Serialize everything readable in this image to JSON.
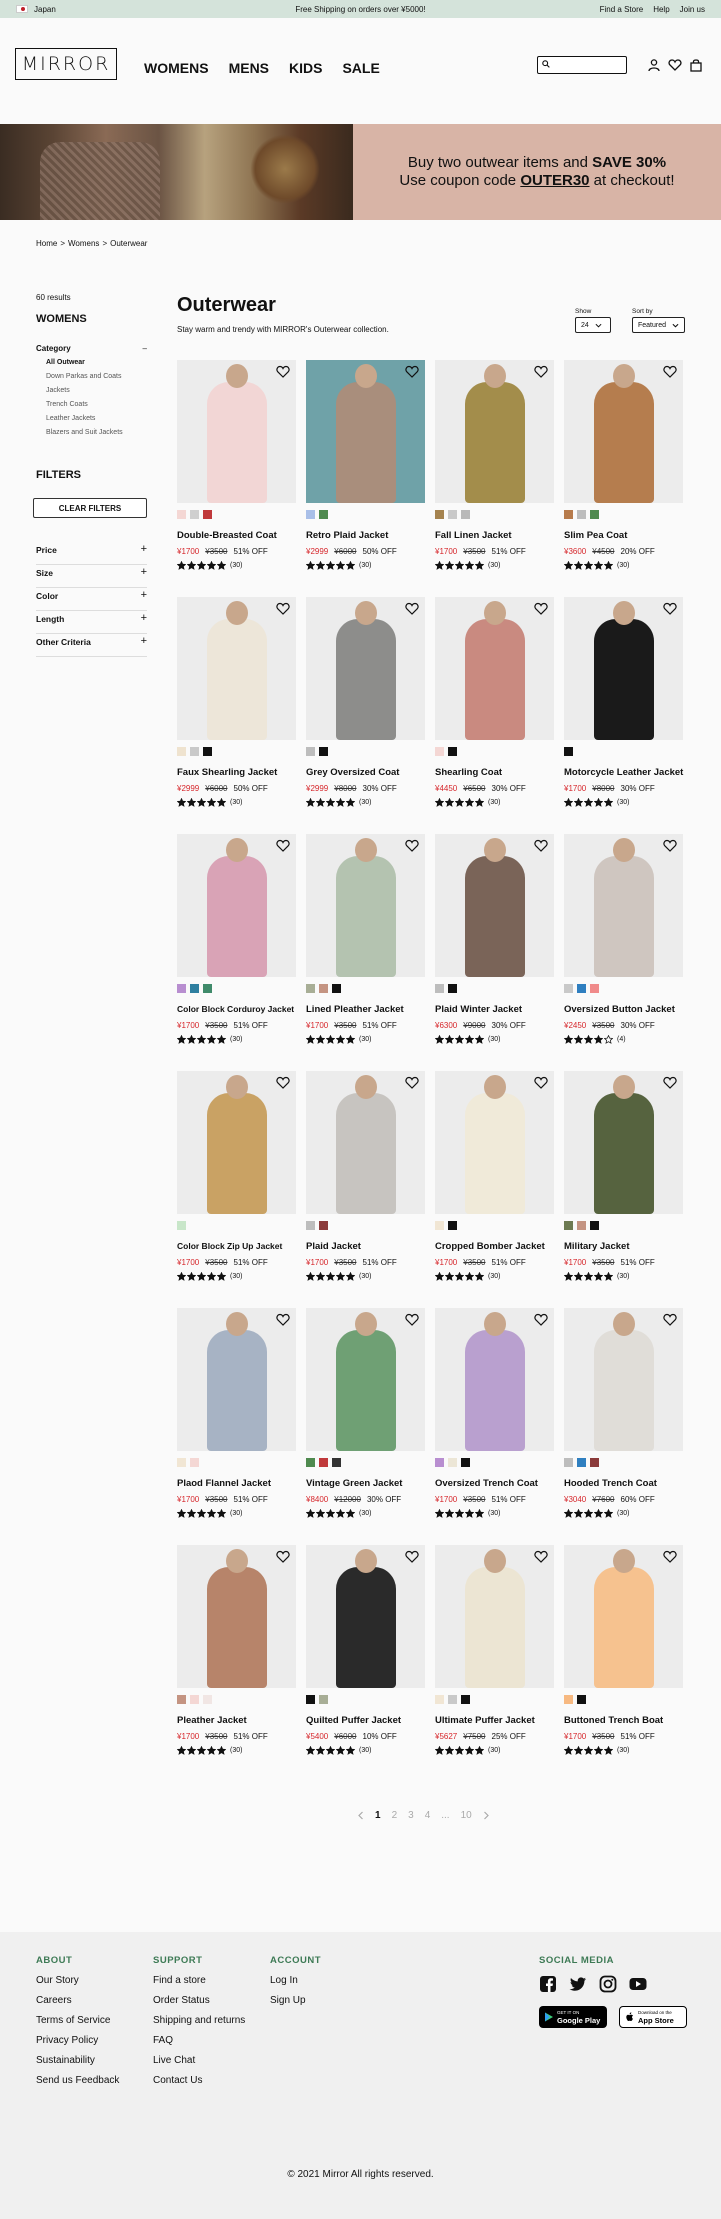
{
  "topbar": {
    "country": "Japan",
    "promo": "Free Shipping on orders over ¥5000!",
    "links": [
      "Find a Store",
      "Help",
      "Join us"
    ]
  },
  "header": {
    "logo": "MIRROR",
    "nav": [
      "WOMENS",
      "MENS",
      "KIDS",
      "SALE"
    ],
    "search_placeholder": "",
    "icons": [
      "user-icon",
      "heart-icon",
      "bag-icon"
    ]
  },
  "hero": {
    "line1_pre": "Buy two outwear items and ",
    "line1_bold": "SAVE 30%",
    "line2_pre": "Use coupon code ",
    "line2_code": "OUTER30",
    "line2_post": " at checkout!"
  },
  "breadcrumb": [
    "Home",
    ">",
    "Womens",
    ">",
    "Outerwear"
  ],
  "sidebar": {
    "results": "60 results",
    "section": "WOMENS",
    "category_label": "Category",
    "category_toggle": "–",
    "categories": [
      "All Outwear",
      "Down Parkas and Coats",
      "Jackets",
      "Trench Coats",
      "Leather Jackets",
      "Blazers and Suit Jackets"
    ],
    "active_category": "All Outwear",
    "filters_title": "FILTERS",
    "clear_filters": "CLEAR FILTERS",
    "facets": [
      "Price",
      "Size",
      "Color",
      "Length",
      "Other Criteria"
    ]
  },
  "content": {
    "title": "Outerwear",
    "subtitle": "Stay warm and trendy with MIRROR's Outerwear collection.",
    "show_label": "Show",
    "show_value": "24",
    "sort_label": "Sort by",
    "sort_value": "Featured"
  },
  "products": [
    {
      "name": "Double-Breasted Coat",
      "sale": "¥1700",
      "orig": "¥3500",
      "off": "51% OFF",
      "stars": 5,
      "reviews": "(30)",
      "swatches": [
        "#f4d7d4",
        "#cfcfcf",
        "#c0393b"
      ],
      "coat": "#f2d6d5",
      "bg": "#ececec"
    },
    {
      "name": "Retro Plaid Jacket",
      "sale": "¥2999",
      "orig": "¥6000",
      "off": "50% OFF",
      "stars": 5,
      "reviews": "(30)",
      "swatches": [
        "#a9bfe8",
        "#4f8a4f"
      ],
      "coat": "#a98e7c",
      "bg": "#6fa2a8"
    },
    {
      "name": "Fall Linen Jacket",
      "sale": "¥1700",
      "orig": "¥3500",
      "off": "51% OFF",
      "stars": 5,
      "reviews": "(30)",
      "swatches": [
        "#a5834f",
        "#c9c9c9",
        "#b9b9b9"
      ],
      "coat": "#a38d4b",
      "bg": "#ececec"
    },
    {
      "name": "Slim Pea Coat",
      "sale": "¥3600",
      "orig": "¥4500",
      "off": "20% OFF",
      "stars": 5,
      "reviews": "(30)",
      "swatches": [
        "#b77b4c",
        "#bdbdbd",
        "#4f8a4f"
      ],
      "coat": "#b57d4e",
      "bg": "#ececec"
    },
    {
      "name": "Faux Shearling Jacket",
      "sale": "¥2999",
      "orig": "¥6000",
      "off": "50% OFF",
      "stars": 5,
      "reviews": "(30)",
      "swatches": [
        "#efe3cf",
        "#c9c9c9",
        "#111111"
      ],
      "coat": "#ede6d9",
      "bg": "#ececec"
    },
    {
      "name": "Grey Oversized Coat",
      "sale": "¥2999",
      "orig": "¥8000",
      "off": "30% OFF",
      "stars": 5,
      "reviews": "(30)",
      "swatches": [
        "#bdbdbd",
        "#111111"
      ],
      "coat": "#8d8d8b",
      "bg": "#ececec"
    },
    {
      "name": "Shearling Coat",
      "sale": "¥4450",
      "orig": "¥6500",
      "off": "30% OFF",
      "stars": 5,
      "reviews": "(30)",
      "swatches": [
        "#f4d7d4",
        "#111111"
      ],
      "coat": "#c98a80",
      "bg": "#ececec"
    },
    {
      "name": "Motorcycle Leather Jacket",
      "sale": "¥1700",
      "orig": "¥8000",
      "off": "30% OFF",
      "stars": 5,
      "reviews": "(30)",
      "swatches": [
        "#111111"
      ],
      "coat": "#1a1a1a",
      "bg": "#ececec"
    },
    {
      "name": "Color Block Corduroy Jacket",
      "sale": "¥1700",
      "orig": "¥3500",
      "off": "51% OFF",
      "stars": 5,
      "reviews": "(30)",
      "swatches": [
        "#b88ed0",
        "#2f7fa0",
        "#3f8a6a"
      ],
      "coat": "#d9a3b6",
      "bg": "#ececec",
      "small": true
    },
    {
      "name": "Lined Pleather Jacket",
      "sale": "¥1700",
      "orig": "¥3500",
      "off": "51% OFF",
      "stars": 5,
      "reviews": "(30)",
      "swatches": [
        "#a8ae96",
        "#c49482",
        "#111111"
      ],
      "coat": "#b4c3b0",
      "bg": "#ececec"
    },
    {
      "name": "Plaid Winter Jacket",
      "sale": "¥6300",
      "orig": "¥9000",
      "off": "30% OFF",
      "stars": 5,
      "reviews": "(30)",
      "swatches": [
        "#bdbdbd",
        "#111111"
      ],
      "coat": "#7a6458",
      "bg": "#ececec"
    },
    {
      "name": "Oversized Button Jacket",
      "sale": "¥2450",
      "orig": "¥3500",
      "off": "30% OFF",
      "stars": 4,
      "reviews": "(4)",
      "swatches": [
        "#c9c9c9",
        "#2f7fc0",
        "#f08a8a"
      ],
      "coat": "#cfc6c0",
      "bg": "#ececec"
    },
    {
      "name": "Color Block Zip Up Jacket",
      "sale": "¥1700",
      "orig": "¥3500",
      "off": "51% OFF",
      "stars": 5,
      "reviews": "(30)",
      "swatches": [
        "#c8e6c9"
      ],
      "coat": "#c9a264",
      "bg": "#ececec",
      "small": true
    },
    {
      "name": "Plaid Jacket",
      "sale": "¥1700",
      "orig": "¥3500",
      "off": "51% OFF",
      "stars": 5,
      "reviews": "(30)",
      "swatches": [
        "#bdbdbd",
        "#8b3a3a"
      ],
      "coat": "#c7c4c0",
      "bg": "#ececec"
    },
    {
      "name": "Cropped Bomber Jacket",
      "sale": "¥1700",
      "orig": "¥3500",
      "off": "51% OFF",
      "stars": 5,
      "reviews": "(30)",
      "swatches": [
        "#f1e6d4",
        "#111111"
      ],
      "coat": "#f0ead9",
      "bg": "#ececec"
    },
    {
      "name": "Military Jacket",
      "sale": "¥1700",
      "orig": "¥3500",
      "off": "51% OFF",
      "stars": 5,
      "reviews": "(30)",
      "swatches": [
        "#6d7a52",
        "#c49482",
        "#111111"
      ],
      "coat": "#56633f",
      "bg": "#ececec"
    },
    {
      "name": "Plaod Flannel Jacket",
      "sale": "¥1700",
      "orig": "¥3500",
      "off": "51% OFF",
      "stars": 5,
      "reviews": "(30)",
      "swatches": [
        "#f1e6d4",
        "#f4d7d4"
      ],
      "coat": "#a7b3c4",
      "bg": "#ececec"
    },
    {
      "name": "Vintage Green Jacket",
      "sale": "¥8400",
      "orig": "¥12000",
      "off": "30% OFF",
      "stars": 5,
      "reviews": "(30)",
      "swatches": [
        "#4f8a4f",
        "#c0393b",
        "#333333"
      ],
      "coat": "#6fa074",
      "bg": "#ececec"
    },
    {
      "name": "Oversized Trench Coat",
      "sale": "¥1700",
      "orig": "¥3500",
      "off": "51% OFF",
      "stars": 5,
      "reviews": "(30)",
      "swatches": [
        "#b88ed0",
        "#ece6d6",
        "#111111"
      ],
      "coat": "#b9a0cf",
      "bg": "#ececec"
    },
    {
      "name": "Hooded Trench Coat",
      "sale": "¥3040",
      "orig": "¥7600",
      "off": "60% OFF",
      "stars": 5,
      "reviews": "(30)",
      "swatches": [
        "#bdbdbd",
        "#2f7fc0",
        "#8b3a3a"
      ],
      "coat": "#e0ddd8",
      "bg": "#ececec"
    },
    {
      "name": "Pleather Jacket",
      "sale": "¥1700",
      "orig": "¥3500",
      "off": "51% OFF",
      "stars": 5,
      "reviews": "(30)",
      "swatches": [
        "#c49482",
        "#f4d7d4",
        "#f1e6e4"
      ],
      "coat": "#b7846a",
      "bg": "#ececec"
    },
    {
      "name": "Quilted Puffer Jacket",
      "sale": "¥5400",
      "orig": "¥6000",
      "off": "10% OFF",
      "stars": 5,
      "reviews": "(30)",
      "swatches": [
        "#111111",
        "#a8ae96"
      ],
      "coat": "#2a2a2a",
      "bg": "#ececec"
    },
    {
      "name": "Ultimate Puffer Jacket",
      "sale": "¥5627",
      "orig": "¥7500",
      "off": "25% OFF",
      "stars": 5,
      "reviews": "(30)",
      "swatches": [
        "#f1e6d4",
        "#c9c9c9",
        "#111111"
      ],
      "coat": "#ece5d3",
      "bg": "#ececec"
    },
    {
      "name": "Buttoned Trench Boat",
      "sale": "¥1700",
      "orig": "¥3500",
      "off": "51% OFF",
      "stars": 5,
      "reviews": "(30)",
      "swatches": [
        "#f7b981",
        "#111111"
      ],
      "coat": "#f6c28f",
      "bg": "#ececec"
    }
  ],
  "pagination": {
    "pages": [
      "1",
      "2",
      "3",
      "4",
      "...",
      "10"
    ],
    "current": "1"
  },
  "footer": {
    "about": {
      "title": "ABOUT",
      "items": [
        "Our Story",
        "Careers",
        "Terms of Service",
        "Privacy Policy",
        "Sustainability",
        "Send us Feedback"
      ]
    },
    "support": {
      "title": "SUPPORT",
      "items": [
        "Find a store",
        "Order Status",
        "Shipping and returns",
        "FAQ",
        "Live Chat",
        "Contact Us"
      ]
    },
    "account": {
      "title": "ACCOUNT",
      "items": [
        "Log In",
        "Sign Up"
      ]
    },
    "social": {
      "title": "SOCIAL MEDIA",
      "icons": [
        "facebook-icon",
        "twitter-icon",
        "instagram-icon",
        "youtube-icon"
      ]
    },
    "google_small": "GET IT ON",
    "google_big": "Google Play",
    "apple_small": "Download on the",
    "apple_big": "App Store",
    "copyright": "© 2021 Mirror All rights reserved."
  },
  "colors": {
    "accent_green": "#3d7a55",
    "sale_red": "#d6262b",
    "topbar": "#d4e3da",
    "hero_bg": "#d8b4a6"
  }
}
